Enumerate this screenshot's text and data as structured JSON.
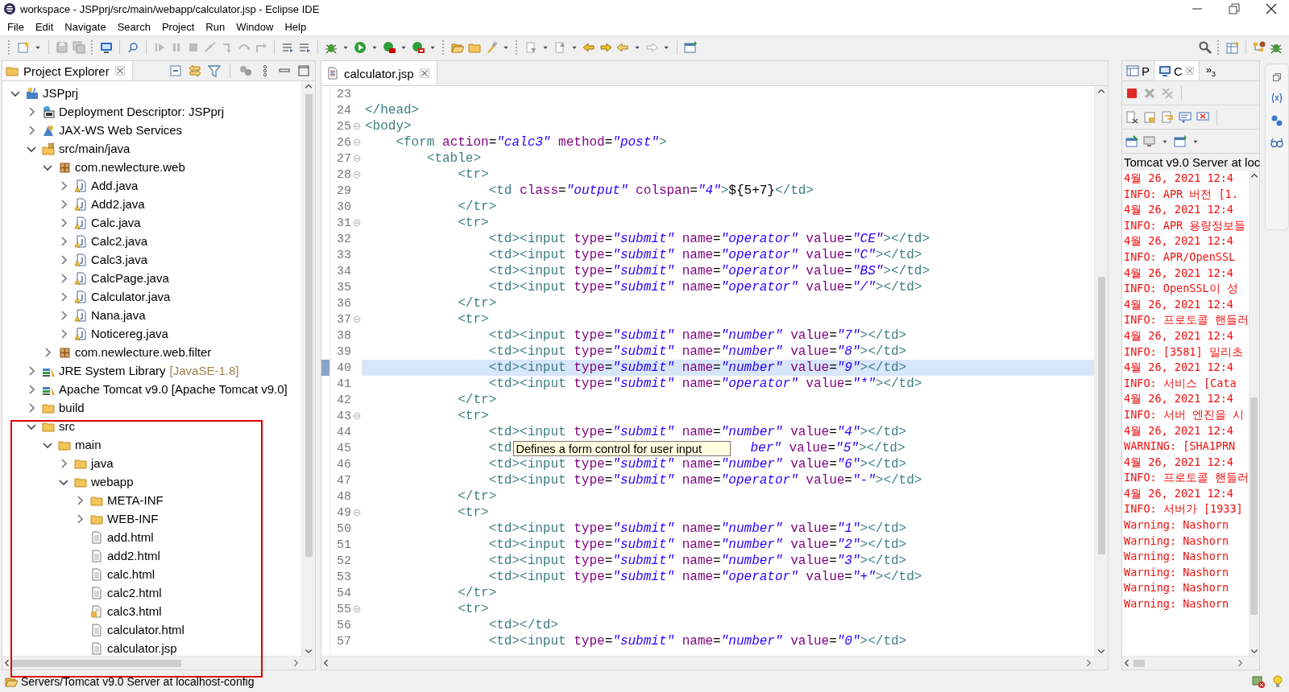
{
  "window": {
    "title": "workspace - JSPprj/src/main/webapp/calculator.jsp - Eclipse IDE"
  },
  "menu": [
    "File",
    "Edit",
    "Navigate",
    "Search",
    "Project",
    "Run",
    "Window",
    "Help"
  ],
  "project_explorer": {
    "title": "Project Explorer",
    "tree": [
      {
        "label": "JSPprj",
        "kind": "project",
        "expanded": true,
        "children": [
          {
            "label": "Deployment Descriptor: JSPprj",
            "kind": "descriptor",
            "expanded": false
          },
          {
            "label": "JAX-WS Web Services",
            "kind": "webservice",
            "expanded": false
          },
          {
            "label": "src/main/java",
            "kind": "source-folder",
            "expanded": true,
            "children": [
              {
                "label": "com.newlecture.web",
                "kind": "package",
                "expanded": true,
                "children": [
                  {
                    "label": "Add.java",
                    "kind": "java",
                    "expanded": false
                  },
                  {
                    "label": "Add2.java",
                    "kind": "java",
                    "expanded": false
                  },
                  {
                    "label": "Calc.java",
                    "kind": "java",
                    "expanded": false
                  },
                  {
                    "label": "Calc2.java",
                    "kind": "java",
                    "expanded": false
                  },
                  {
                    "label": "Calc3.java",
                    "kind": "java",
                    "expanded": false
                  },
                  {
                    "label": "CalcPage.java",
                    "kind": "java",
                    "expanded": false
                  },
                  {
                    "label": "Calculator.java",
                    "kind": "java",
                    "expanded": false
                  },
                  {
                    "label": "Nana.java",
                    "kind": "java",
                    "expanded": false
                  },
                  {
                    "label": "Noticereg.java",
                    "kind": "java",
                    "expanded": false
                  }
                ]
              },
              {
                "label": "com.newlecture.web.filter",
                "kind": "package",
                "expanded": false
              }
            ]
          },
          {
            "label": "JRE System Library",
            "decoration": "[JavaSE-1.8]",
            "kind": "library",
            "expanded": false
          },
          {
            "label": "Apache Tomcat v9.0 [Apache Tomcat v9.0]",
            "kind": "library",
            "expanded": false
          },
          {
            "label": "build",
            "kind": "folder",
            "expanded": false
          },
          {
            "label": "src",
            "kind": "folder",
            "expanded": true,
            "children": [
              {
                "label": "main",
                "kind": "folder",
                "expanded": true,
                "children": [
                  {
                    "label": "java",
                    "kind": "folder",
                    "expanded": false
                  },
                  {
                    "label": "webapp",
                    "kind": "folder",
                    "expanded": true,
                    "children": [
                      {
                        "label": "META-INF",
                        "kind": "folder",
                        "expanded": false
                      },
                      {
                        "label": "WEB-INF",
                        "kind": "folder",
                        "expanded": false
                      },
                      {
                        "label": "add.html",
                        "kind": "file"
                      },
                      {
                        "label": "add2.html",
                        "kind": "file"
                      },
                      {
                        "label": "calc.html",
                        "kind": "file"
                      },
                      {
                        "label": "calc2.html",
                        "kind": "file"
                      },
                      {
                        "label": "calc3.html",
                        "kind": "web-file"
                      },
                      {
                        "label": "calculator.html",
                        "kind": "file"
                      },
                      {
                        "label": "calculator.jsp",
                        "kind": "file"
                      }
                    ]
                  }
                ]
              }
            ]
          }
        ]
      }
    ]
  },
  "editor": {
    "tab": "calculator.jsp",
    "lines": [
      {
        "number": "23",
        "fold": false,
        "current": false
      },
      {
        "number": "24",
        "text": "</head>",
        "fold": false,
        "current": false
      },
      {
        "number": "25",
        "text": "<body>",
        "fold": true,
        "current": false
      },
      {
        "number": "26",
        "text": "\t<form action=\"calc3\" method=\"post\">",
        "fold": true,
        "current": false
      },
      {
        "number": "27",
        "text": "\t\t<table>",
        "fold": true,
        "current": false
      },
      {
        "number": "28",
        "text": "\t\t\t<tr>",
        "fold": true,
        "current": false
      },
      {
        "number": "29",
        "text": "\t\t\t\t<td class=\"output\" colspan=\"4\">${5+7}</td>",
        "fold": false,
        "current": false
      },
      {
        "number": "30",
        "text": "\t\t\t</tr>",
        "fold": false,
        "current": false
      },
      {
        "number": "31",
        "text": "\t\t\t<tr>",
        "fold": true,
        "current": false
      },
      {
        "number": "32",
        "text": "\t\t\t\t<td><input type=\"submit\" name=\"operator\" value=\"CE\"></td>",
        "fold": false,
        "current": false
      },
      {
        "number": "33",
        "text": "\t\t\t\t<td><input type=\"submit\" name=\"operator\" value=\"C\"></td>",
        "fold": false,
        "current": false
      },
      {
        "number": "34",
        "text": "\t\t\t\t<td><input type=\"submit\" name=\"operator\" value=\"BS\"></td>",
        "fold": false,
        "current": false
      },
      {
        "number": "35",
        "text": "\t\t\t\t<td><input type=\"submit\" name=\"operator\" value=\"/\"></td>",
        "fold": false,
        "current": false
      },
      {
        "number": "36",
        "text": "\t\t\t</tr>",
        "fold": false,
        "current": false
      },
      {
        "number": "37",
        "text": "\t\t\t<tr>",
        "fold": true,
        "current": false
      },
      {
        "number": "38",
        "text": "\t\t\t\t<td><input type=\"submit\" name=\"number\" value=\"7\"></td>",
        "fold": false,
        "current": false
      },
      {
        "number": "39",
        "text": "\t\t\t\t<td><input type=\"submit\" name=\"number\" value=\"8\"></td>",
        "fold": false,
        "current": false
      },
      {
        "number": "40",
        "text": "\t\t\t\t<td><input type=\"submit\" name=\"number\" value=\"9\"></td>",
        "fold": false,
        "current": true
      },
      {
        "number": "41",
        "text": "\t\t\t\t<td><input type=\"submit\" name=\"operator\" value=\"*\"></td>",
        "fold": false,
        "current": false
      },
      {
        "number": "42",
        "text": "\t\t\t</tr>",
        "fold": false,
        "current": false
      },
      {
        "number": "43",
        "text": "\t\t\t<tr>",
        "fold": true,
        "current": false
      },
      {
        "number": "44",
        "text": "\t\t\t\t<td><input type=\"submit\" name=\"number\" value=\"4\"></td>",
        "fold": false,
        "current": false
      },
      {
        "number": "45",
        "text": "\t\t\t\t<td",
        "tooltip": "Defines a form control for user input",
        "text_after": "ber\" value=\"5\"></td>",
        "fold": false,
        "current": false
      },
      {
        "number": "46",
        "text": "\t\t\t\t<td><input type=\"submit\" name=\"number\" value=\"6\"></td>",
        "fold": false,
        "current": false
      },
      {
        "number": "47",
        "text": "\t\t\t\t<td><input type=\"submit\" name=\"operator\" value=\"-\"></td>",
        "fold": false,
        "current": false
      },
      {
        "number": "48",
        "text": "\t\t\t</tr>",
        "fold": false,
        "current": false
      },
      {
        "number": "49",
        "text": "\t\t\t<tr>",
        "fold": true,
        "current": false
      },
      {
        "number": "50",
        "text": "\t\t\t\t<td><input type=\"submit\" name=\"number\" value=\"1\"></td>",
        "fold": false,
        "current": false
      },
      {
        "number": "51",
        "text": "\t\t\t\t<td><input type=\"submit\" name=\"number\" value=\"2\"></td>",
        "fold": false,
        "current": false
      },
      {
        "number": "52",
        "text": "\t\t\t\t<td><input type=\"submit\" name=\"number\" value=\"3\"></td>",
        "fold": false,
        "current": false
      },
      {
        "number": "53",
        "text": "\t\t\t\t<td><input type=\"submit\" name=\"operator\" value=\"+\"></td>",
        "fold": false,
        "current": false
      },
      {
        "number": "54",
        "text": "\t\t\t</tr>",
        "fold": false,
        "current": false
      },
      {
        "number": "55",
        "text": "\t\t\t<tr>",
        "fold": true,
        "current": false
      },
      {
        "number": "56",
        "text": "\t\t\t\t<td></td>",
        "fold": false,
        "current": false
      },
      {
        "number": "57",
        "text": "\t\t\t\t<td><input type=\"submit\" name=\"number\" value=\"0\"></td>",
        "fold": false,
        "current": false
      }
    ]
  },
  "console_panel": {
    "tabs": [
      {
        "label": "P",
        "selected": false
      },
      {
        "label": "C",
        "selected": true
      }
    ],
    "overflow": {
      "label": "»",
      "count": "3"
    },
    "title": "Tomcat v9.0 Server at loc",
    "lines": [
      "4월 26, 2021 12:4",
      "INFO: APR 버전 [1.",
      "4월 26, 2021 12:4",
      "INFO: APR 용량정보들",
      "4월 26, 2021 12:4",
      "INFO: APR/OpenSSL",
      "4월 26, 2021 12:4",
      "INFO: OpenSSL이 성",
      "4월 26, 2021 12:4",
      "INFO: 프로토콜 핸들러",
      "4월 26, 2021 12:4",
      "INFO: [3581] 밀리초",
      "4월 26, 2021 12:4",
      "INFO: 서비스 [Cata",
      "4월 26, 2021 12:4",
      "INFO: 서버 엔진을 시",
      "4월 26, 2021 12:4",
      "WARNING: [SHA1PRN",
      "4월 26, 2021 12:4",
      "INFO: 프로토콜 핸들러",
      "4월 26, 2021 12:4",
      "INFO: 서버가 [1933]",
      "Warning: Nashorn",
      "Warning: Nashorn",
      "Warning: Nashorn",
      "Warning: Nashorn",
      "Warning: Nashorn",
      "Warning: Nashorn"
    ]
  },
  "status_bar": {
    "text": "Servers/Tomcat v9.0 Server at localhost-config"
  }
}
